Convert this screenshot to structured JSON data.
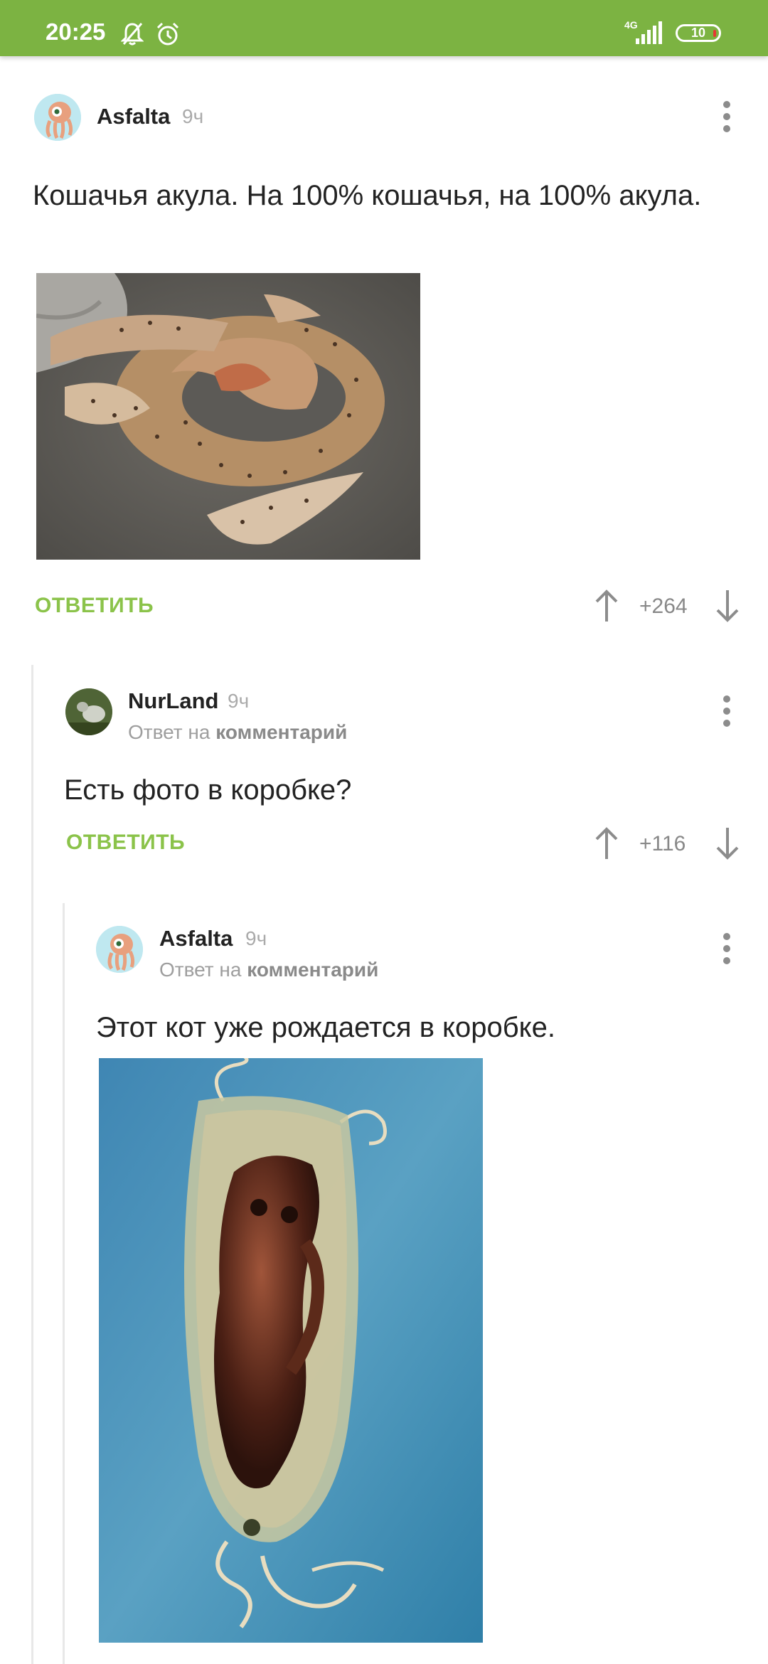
{
  "status_bar": {
    "time": "20:25",
    "network": "4G",
    "battery": "10"
  },
  "comments": [
    {
      "author": "Asfalta",
      "time": "9ч",
      "text": "Кошачья акула. На 100% кошачья, на 100% акула.",
      "reply_label": "ОТВЕТИТЬ",
      "score": "+264",
      "has_image": true
    },
    {
      "author": "NurLand",
      "time": "9ч",
      "reply_to_prefix": "Ответ на",
      "reply_to_link": "комментарий",
      "text": "Есть фото в коробке?",
      "reply_label": "ОТВЕТИТЬ",
      "score": "+116"
    },
    {
      "author": "Asfalta",
      "time": "9ч",
      "reply_to_prefix": "Ответ на",
      "reply_to_link": "комментарий",
      "text": "Этот кот уже рождается в коробке.",
      "has_image": true
    }
  ],
  "colors": {
    "accent": "#7cb342",
    "reply_button": "#8bc34a",
    "muted": "#9e9e9e"
  }
}
